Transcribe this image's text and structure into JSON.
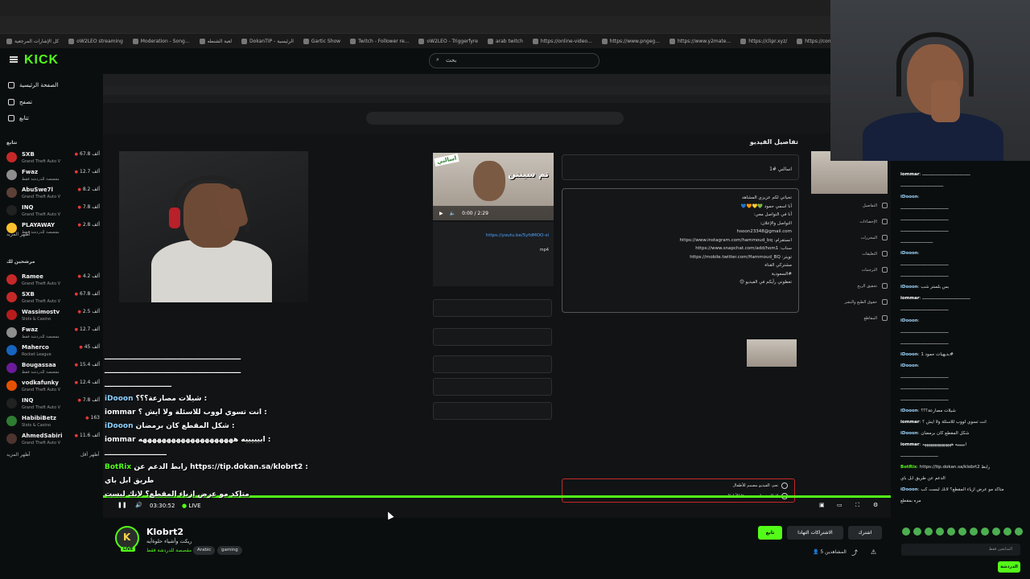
{
  "browser": {
    "bookmarks": [
      "كل الإشارات المرجعية",
      "oW2LEO streaming",
      "Moderation - Song...",
      "لعبة الشنطه",
      "DokanTIP - الرئيسية",
      "Gartic Show",
      "Twitch - Follower re...",
      "oW2LEO - Triggerfyre",
      "arab twitch",
      "https://online-video...",
      "https://www.pngeg...",
      "https://www.y2mate...",
      "https://clipr.xyz/",
      "https://convert-"
    ]
  },
  "kick": {
    "logo": "KICK",
    "search_placeholder": "بحث",
    "nav": [
      "الصفحة الرئيسية",
      "تصفح",
      "تتابع"
    ],
    "following_title": "تتابع",
    "recommended_title": "مرشحين لك",
    "show_more": "أظهر المزيد",
    "show_less": "أظهر أقل",
    "following": [
      {
        "name": "SXB",
        "game": "Grand Theft Auto V",
        "viewers": "67.8 ألف",
        "color": "#c62828"
      },
      {
        "name": "Fwaz",
        "game": "مقصصة للدردشة فقط",
        "viewers": "12.7 ألف",
        "color": "#8e8e8e"
      },
      {
        "name": "AbuSwe7l",
        "game": "Grand Theft Auto V",
        "viewers": "8.2 ألف",
        "color": "#5d4037"
      },
      {
        "name": "INQ",
        "game": "Grand Theft Auto V",
        "viewers": "7.8 ألف",
        "color": "#212121"
      },
      {
        "name": "PLAYAWAY",
        "game": "مقصصة للدردشة فقط",
        "viewers": "2.8 ألف",
        "color": "#fbc02d"
      }
    ],
    "recommended": [
      {
        "name": "Ramee",
        "game": "Grand Theft Auto V",
        "viewers": "4.2 ألف",
        "color": "#c62828"
      },
      {
        "name": "SXB",
        "game": "Grand Theft Auto V",
        "viewers": "67.8 ألف",
        "color": "#c62828"
      },
      {
        "name": "Wassimostv",
        "game": "Slots & Casino",
        "viewers": "2.5 ألف",
        "color": "#b71c1c"
      },
      {
        "name": "Fwaz",
        "game": "مقصصة للدردشة فقط",
        "viewers": "12.7 ألف",
        "color": "#8e8e8e"
      },
      {
        "name": "Maherco",
        "game": "Rocket League",
        "viewers": "45 ألف",
        "color": "#1565c0"
      },
      {
        "name": "Bougassaa",
        "game": "مقصصة للدردشة فقط",
        "viewers": "15.4 ألف",
        "color": "#6a1b9a"
      },
      {
        "name": "vodkafunky",
        "game": "Grand Theft Auto V",
        "viewers": "12.4 ألف",
        "color": "#e65100"
      },
      {
        "name": "INQ",
        "game": "Grand Theft Auto V",
        "viewers": "7.8 ألف",
        "color": "#212121"
      },
      {
        "name": "HabibiBetz",
        "game": "Slots & Casino",
        "viewers": "163",
        "color": "#2e7d32"
      },
      {
        "name": "AhmedSabiri",
        "game": "Grand Theft Auto V",
        "viewers": "11.6 ألف",
        "color": "#4e342e"
      }
    ]
  },
  "studio": {
    "details_title": "تفاصيل الفيديو",
    "title_value": "اسالني #1",
    "thumb_tag": "اسالني",
    "thumb_text": "تم سينتن",
    "time": "0:00 / 2:29",
    "video_link": "https://youtu.be/5yfdMOO-sI",
    "format": "mp4",
    "desc_lines": [
      "تحياتي لكم عزيزي المشاهد",
      "أنا اسمي حمود 💚💛🧡💙",
      "أنا في التواصل معي:",
      "التواصل والإعلان:",
      "hsoon23348@gmail.com",
      "انستقرام: https://www.instagram.com/hammoud_bq",
      "سناب: https://www.snapchat.com/add/hom1",
      "تويتر: https://mobile.twitter.com/Hammoud_BQ",
      "مشتركي القناة",
      "#السعودية",
      "تعطوني رأيكم في الفيديو 😊"
    ],
    "audience_yes": "نعم، الفيديو مصمم للأطفال",
    "audience_no": "لا، الفيديو ليس مصممًا للأطفال",
    "nav": [
      "التفاصيل",
      "الإحصاءات",
      "المحررات",
      "التعليقات",
      "الترجمات",
      "تحقيق الربح",
      "حقوق الطبع والنشر",
      "المقاطع"
    ]
  },
  "overlay_chat": [
    {
      "user": "",
      "text": "ـــــــــــــــــــــــــــــــــــــــــــــــــــــــ"
    },
    {
      "user": "",
      "text": "ـــــــــــــــــــــــــــــــــــــــــــــــــــــــ"
    },
    {
      "user": "",
      "text": "ـــــــــــــــــــــــــــ"
    },
    {
      "user": "iDooon",
      "text": "شيلات مصارعة؟؟؟ :"
    },
    {
      "user": "iommar",
      "text": "انت تسوي لووب للاسئلة ولا ايش ؟ :"
    },
    {
      "user": "iDooon",
      "text": "شكل المقطع كان برمضان :"
    },
    {
      "user": "iommar",
      "text": "ابيييييه ههههههههههههههههههههه :"
    },
    {
      "user": "",
      "text": "ـــــــــــــــــــــــــ"
    },
    {
      "user": "BotRix",
      "text": "رابط الدعم عن https://tip.dokan.sa/klobrt2 :"
    },
    {
      "user": "",
      "text": "طريق ابل باي"
    },
    {
      "user": "",
      "text": "متاكد مو عرض ازياء المقطع؟ لانك لبست"
    }
  ],
  "player": {
    "time": "03:30:52",
    "live": "LIVE"
  },
  "chat_panel": [
    {
      "user": "iommar",
      "text": "ـــــــــــــــــــــــــــــــــــــ"
    },
    {
      "user": "",
      "text": "ـــــــــــــــــــــــــــــــــ"
    },
    {
      "user": "iDooon",
      "text": ""
    },
    {
      "user": "",
      "text": "ـــــــــــــــــــــــــــــــــــــ"
    },
    {
      "user": "",
      "text": "ـــــــــــــــــــــــــــــــــــــ"
    },
    {
      "user": "",
      "text": "ـــــــــــــــــــــــــــــــــــــ"
    },
    {
      "user": "",
      "text": "ـــــــــــــــــــــــــ"
    },
    {
      "user": "iDooon",
      "text": ""
    },
    {
      "user": "",
      "text": "ـــــــــــــــــــــــــــــــــــــ"
    },
    {
      "user": "",
      "text": "ـــــــــــــــــــــــــــــــــــــ"
    },
    {
      "user": "iDooon",
      "text": "بس بلستر شب"
    },
    {
      "user": "iommar",
      "text": "ـــــــــــــــــــــــــــــــــــــ"
    },
    {
      "user": "",
      "text": "ـــــــــــــــــــــــــــــــــــــ"
    },
    {
      "user": "iDooon",
      "text": ""
    },
    {
      "user": "",
      "text": "ـــــــــــــــــــــــــــــــــــــ"
    },
    {
      "user": "",
      "text": "ـــــــــــــــــــــــــــــــــــــ"
    },
    {
      "user": "iDooon",
      "text": "بديهيات حمود 1#"
    },
    {
      "user": "iDooon",
      "text": ""
    },
    {
      "user": "",
      "text": "ـــــــــــــــــــــــــــــــــــــ"
    },
    {
      "user": "",
      "text": "ـــــــــــــــــــــــــــــــــــــ"
    },
    {
      "user": "",
      "text": "ـــــــــــــــــــــــــــــــــــــ"
    },
    {
      "user": "iDooon",
      "text": "شيلات مصارعة؟؟؟"
    },
    {
      "user": "iommar",
      "text": "انت تسوي لووب للاسئلة ولا ايش ؟"
    },
    {
      "user": "iDooon",
      "text": "شكل المقطع كان برمضان"
    },
    {
      "user": "iommar",
      "text": "ابيييييه ههههههههههههههه"
    },
    {
      "user": "",
      "text": "ـــــــــــــــــــــــــــــ"
    },
    {
      "user": "BotRix",
      "text": "https://tip.dokan.sa/klobrt2 رابط"
    },
    {
      "user": "",
      "text": "الدعم عن طريق ابل باي"
    },
    {
      "user": "iDooon",
      "text": "متاكد مو عرض ازياء المقطع؟ لانك لبست كب"
    },
    {
      "user": "",
      "text": "مره بمقطع"
    }
  ],
  "chat_input_placeholder": "المتابعين فقط",
  "chat_send": "الدردشة",
  "channel": {
    "name": "Klobrt2",
    "title": "ريكت وأشياء حلوةأيه",
    "category": "مقصصة للدردشة فقط",
    "tags": [
      "Arabic",
      "gaming"
    ],
    "follow": "تابع",
    "gift": "الاشتراكات التهادا",
    "subscribe": "اشترك",
    "viewers": "المشاهدين 5"
  }
}
